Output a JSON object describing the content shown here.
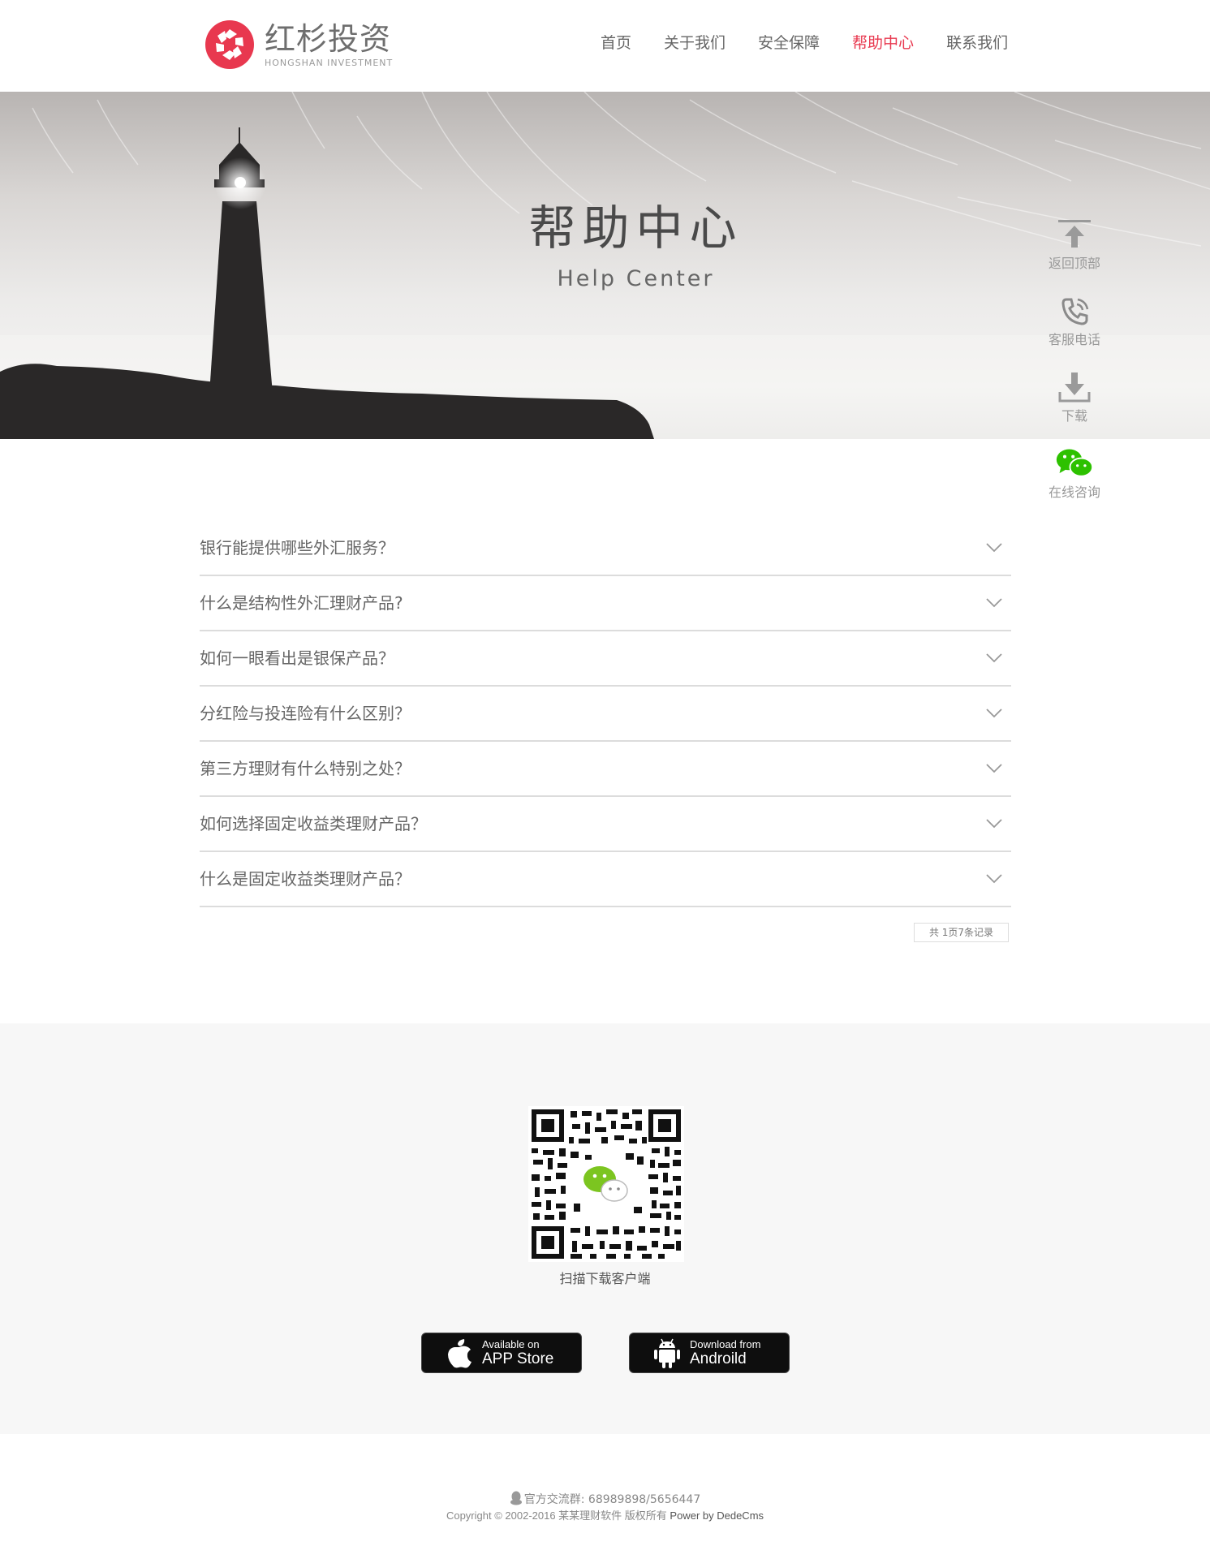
{
  "colors": {
    "accent": "#e8384f",
    "text": "#666666",
    "divider": "#dcdcdc",
    "wechat": "#2dc100"
  },
  "header": {
    "logo_title": "红杉投资",
    "logo_subtitle": "HONGSHAN INVESTMENT",
    "nav": [
      {
        "label": "首页",
        "active": false
      },
      {
        "label": "关于我们",
        "active": false
      },
      {
        "label": "安全保障",
        "active": false
      },
      {
        "label": "帮助中心",
        "active": true
      },
      {
        "label": "联系我们",
        "active": false
      }
    ]
  },
  "banner": {
    "title": "帮助中心",
    "subtitle": "Help Center"
  },
  "float_bar": [
    {
      "label": "返回顶部",
      "icon": "arrow-up-icon"
    },
    {
      "label": "客服电话",
      "icon": "phone-icon"
    },
    {
      "label": "下载",
      "icon": "download-icon"
    },
    {
      "label": "在线咨询",
      "icon": "wechat-icon"
    }
  ],
  "faq": [
    {
      "question": "银行能提供哪些外汇服务？"
    },
    {
      "question": "什么是结构性外汇理财产品?"
    },
    {
      "question": "如何一眼看出是银保产品？"
    },
    {
      "question": "分红险与投连险有什么区别？"
    },
    {
      "question": "第三方理财有什么特别之处？"
    },
    {
      "question": "如何选择固定收益类理财产品？"
    },
    {
      "question": "什么是固定收益类理财产品？"
    }
  ],
  "pager": {
    "text": "共 1页7条记录"
  },
  "download": {
    "qr_caption": "扫描下载客户端",
    "appstore": {
      "line1": "Available on",
      "line2": "APP Store",
      "icon": "apple-icon"
    },
    "android": {
      "line1": "Download from",
      "line2": "Androild",
      "icon": "android-icon"
    }
  },
  "footer": {
    "qq_group": "官方交流群: 68989898/5656447",
    "copyright": "Copyright © 2002-2016 某某理财软件 版权所有",
    "powered": "Power by DedeCms"
  }
}
